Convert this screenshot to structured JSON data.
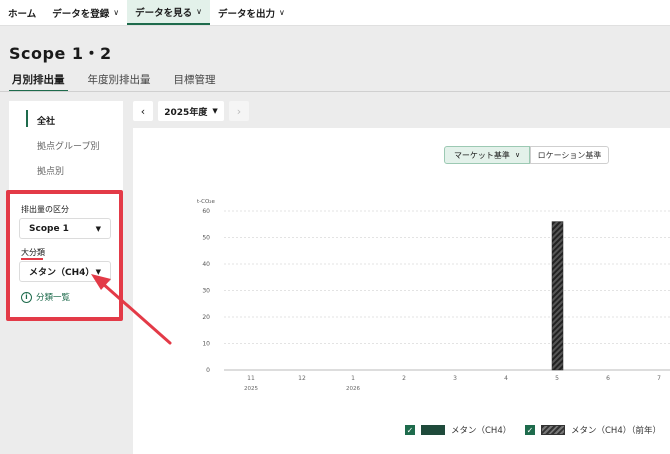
{
  "nav": [
    {
      "label": "ホーム",
      "dropdown": false,
      "active": false
    },
    {
      "label": "データを登録",
      "dropdown": true,
      "active": false
    },
    {
      "label": "データを見る",
      "dropdown": true,
      "active": true
    },
    {
      "label": "データを出力",
      "dropdown": true,
      "active": false
    }
  ],
  "page_title": "Scope 1・2",
  "tabs": [
    "月別排出量",
    "年度別排出量",
    "目標管理"
  ],
  "sidebar": {
    "items": [
      "全社",
      "拠点グループ別",
      "拠点別"
    ],
    "emission_label": "排出量の区分",
    "emission_value": "Scope 1",
    "category_label": "大分類",
    "category_value": "メタン（CH4）",
    "info_link": "分類一覧"
  },
  "year": {
    "prev": "‹",
    "label": "2025年度",
    "next": "›"
  },
  "basis": {
    "market": "マーケット基準",
    "location": "ロケーション基準"
  },
  "colors": {
    "accent": "#1e6b4c",
    "highlight": "#e33a47"
  },
  "chart_data": {
    "type": "bar",
    "ylabel": "t-CO₂e",
    "ylim": [
      0,
      60
    ],
    "yticks": [
      0,
      10,
      20,
      30,
      40,
      50,
      60
    ],
    "categories": [
      "11",
      "12",
      "1",
      "2",
      "3",
      "4",
      "5",
      "6",
      "7"
    ],
    "year_labels": {
      "0": "2025",
      "2": "2026"
    },
    "series": [
      {
        "name": "メタン（CH4）",
        "values": [
          0,
          0,
          0,
          0,
          0,
          0,
          0,
          0,
          0
        ]
      },
      {
        "name": "メタン（CH4）（前年）",
        "values": [
          0,
          0,
          0,
          0,
          0,
          0,
          56,
          0,
          0
        ]
      }
    ],
    "grid": true
  }
}
